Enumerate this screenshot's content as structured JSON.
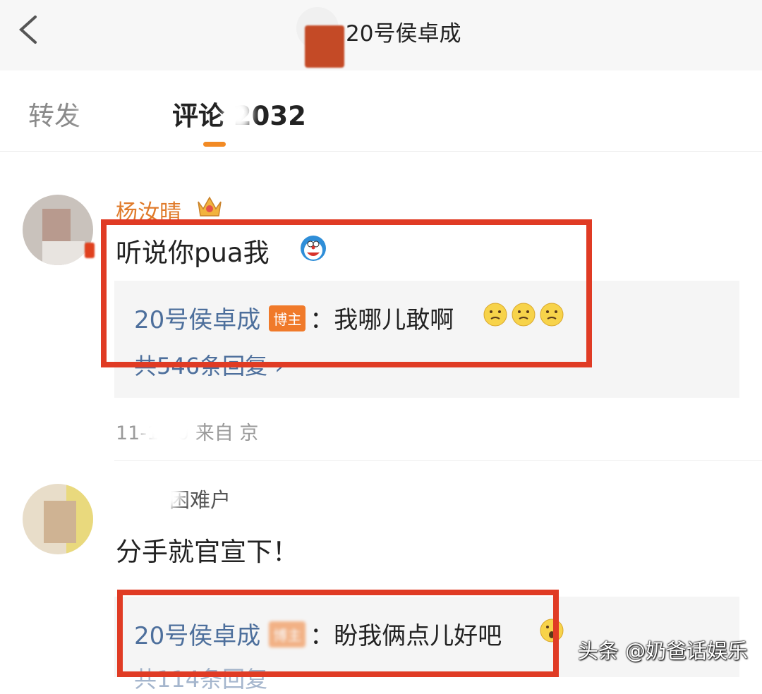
{
  "header": {
    "title": "20号侯卓成"
  },
  "tabs": {
    "forward_label": "转发",
    "comments_label": "评论 2032"
  },
  "comments": [
    {
      "username": "杨汝晴",
      "text": "听说你pua我",
      "reply": {
        "author": "20号侯卓成",
        "badge": "博主",
        "text": "：我哪儿敢啊",
        "count": "共546条回复 ›"
      },
      "meta": "11-1   40 来自   京"
    },
    {
      "username": "困难户",
      "text": "分手就官宣下！",
      "reply": {
        "author": "20号侯卓成",
        "badge": "博主",
        "text": "：盼我俩点儿好吧",
        "count": "共114条回复"
      }
    }
  ],
  "watermark": "头条 @奶爸话娱乐",
  "colors": {
    "highlight": "#e03b24",
    "accent": "#f28a24",
    "link": "#4d6f9c",
    "username": "#e07b2b"
  }
}
